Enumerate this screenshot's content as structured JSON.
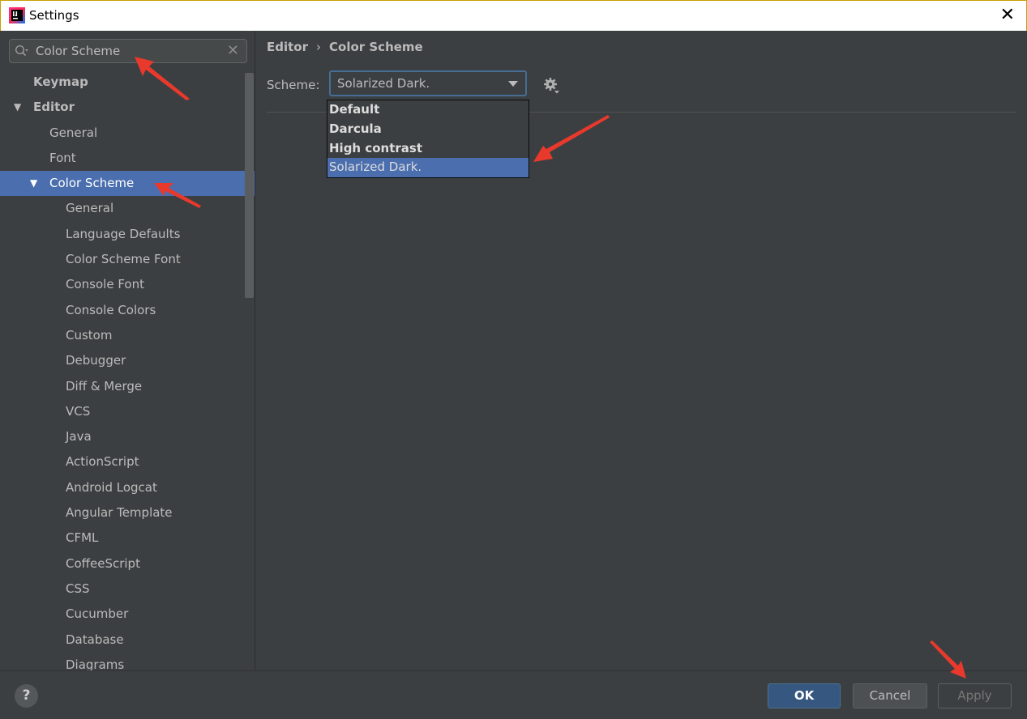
{
  "window": {
    "title": "Settings"
  },
  "search": {
    "value": "Color Scheme"
  },
  "tree": [
    {
      "label": "Keymap",
      "level": 0,
      "bold": true,
      "expanded": null,
      "selected": false
    },
    {
      "label": "Editor",
      "level": 0,
      "bold": true,
      "expanded": true,
      "selected": false
    },
    {
      "label": "General",
      "level": 1,
      "bold": false,
      "expanded": null,
      "selected": false
    },
    {
      "label": "Font",
      "level": 1,
      "bold": false,
      "expanded": null,
      "selected": false
    },
    {
      "label": "Color Scheme",
      "level": 1,
      "bold": false,
      "expanded": true,
      "selected": true
    },
    {
      "label": "General",
      "level": 2,
      "bold": false,
      "expanded": null,
      "selected": false
    },
    {
      "label": "Language Defaults",
      "level": 2,
      "bold": false,
      "expanded": null,
      "selected": false
    },
    {
      "label": "Color Scheme Font",
      "level": 2,
      "bold": false,
      "expanded": null,
      "selected": false
    },
    {
      "label": "Console Font",
      "level": 2,
      "bold": false,
      "expanded": null,
      "selected": false
    },
    {
      "label": "Console Colors",
      "level": 2,
      "bold": false,
      "expanded": null,
      "selected": false
    },
    {
      "label": "Custom",
      "level": 2,
      "bold": false,
      "expanded": null,
      "selected": false
    },
    {
      "label": "Debugger",
      "level": 2,
      "bold": false,
      "expanded": null,
      "selected": false
    },
    {
      "label": "Diff & Merge",
      "level": 2,
      "bold": false,
      "expanded": null,
      "selected": false
    },
    {
      "label": "VCS",
      "level": 2,
      "bold": false,
      "expanded": null,
      "selected": false
    },
    {
      "label": "Java",
      "level": 2,
      "bold": false,
      "expanded": null,
      "selected": false
    },
    {
      "label": "ActionScript",
      "level": 2,
      "bold": false,
      "expanded": null,
      "selected": false
    },
    {
      "label": "Android Logcat",
      "level": 2,
      "bold": false,
      "expanded": null,
      "selected": false
    },
    {
      "label": "Angular Template",
      "level": 2,
      "bold": false,
      "expanded": null,
      "selected": false
    },
    {
      "label": "CFML",
      "level": 2,
      "bold": false,
      "expanded": null,
      "selected": false
    },
    {
      "label": "CoffeeScript",
      "level": 2,
      "bold": false,
      "expanded": null,
      "selected": false
    },
    {
      "label": "CSS",
      "level": 2,
      "bold": false,
      "expanded": null,
      "selected": false
    },
    {
      "label": "Cucumber",
      "level": 2,
      "bold": false,
      "expanded": null,
      "selected": false
    },
    {
      "label": "Database",
      "level": 2,
      "bold": false,
      "expanded": null,
      "selected": false
    },
    {
      "label": "Diagrams",
      "level": 2,
      "bold": false,
      "expanded": null,
      "selected": false
    }
  ],
  "main": {
    "breadcrumb": [
      "Editor",
      "Color Scheme"
    ],
    "breadcrumb_separator": "›",
    "scheme_label": "Scheme:",
    "scheme_value": "Solarized Dark.",
    "scheme_options": [
      {
        "label": "Default",
        "bold": true,
        "selected": false
      },
      {
        "label": "Darcula",
        "bold": true,
        "selected": false
      },
      {
        "label": "High contrast",
        "bold": true,
        "selected": false
      },
      {
        "label": "Solarized Dark.",
        "bold": false,
        "selected": true
      }
    ]
  },
  "footer": {
    "help_label": "?",
    "ok_label": "OK",
    "cancel_label": "Cancel",
    "apply_label": "Apply",
    "apply_enabled": false
  },
  "colors": {
    "background": "#3c3f41",
    "selection": "#4b6eaf",
    "primary_button": "#365880",
    "annotation_arrow": "#e8392c"
  }
}
